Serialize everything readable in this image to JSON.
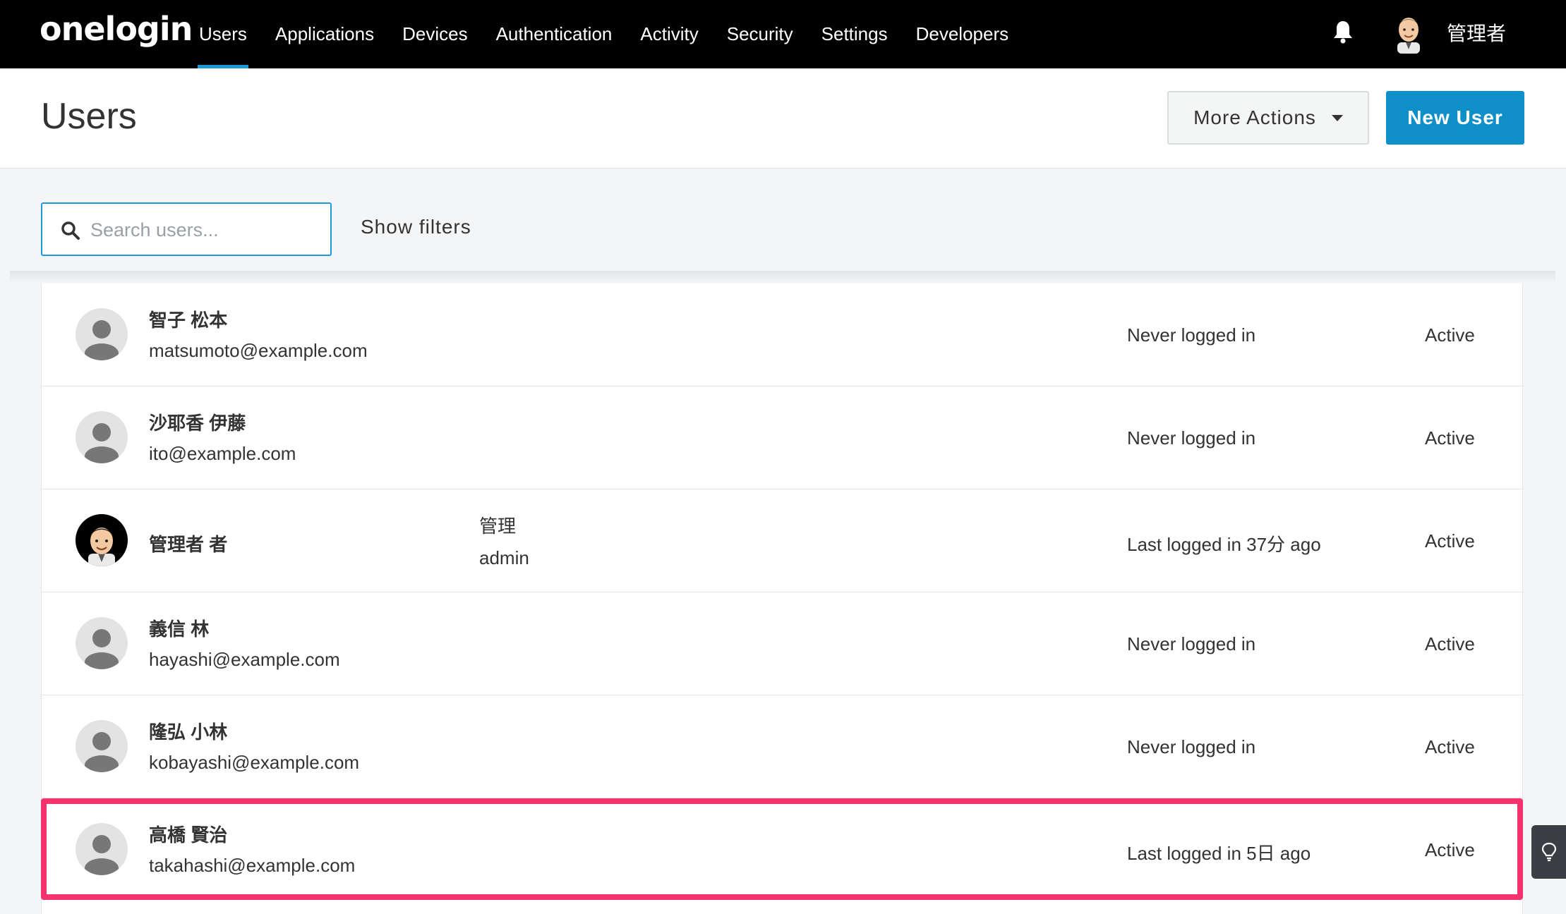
{
  "app": {
    "logo": "onelogin",
    "user_name": "管理者"
  },
  "nav": [
    {
      "label": "Users",
      "active": true
    },
    {
      "label": "Applications"
    },
    {
      "label": "Devices"
    },
    {
      "label": "Authentication"
    },
    {
      "label": "Activity"
    },
    {
      "label": "Security"
    },
    {
      "label": "Settings"
    },
    {
      "label": "Developers"
    }
  ],
  "header": {
    "title": "Users",
    "more_actions_label": "More Actions",
    "new_user_label": "New User"
  },
  "search": {
    "placeholder": "Search users...",
    "value": "",
    "show_filters_label": "Show filters"
  },
  "users": [
    {
      "name": "智子 松本",
      "email": "matsumoto@example.com",
      "last_login": "Never logged in",
      "status": "Active"
    },
    {
      "name": "沙耶香 伊藤",
      "email": "ito@example.com",
      "last_login": "Never logged in",
      "status": "Active"
    },
    {
      "name": "管理者 者",
      "role_1": "管理",
      "role_2": "admin",
      "last_login": "Last logged in 37分 ago",
      "status": "Active"
    },
    {
      "name": "義信 林",
      "email": "hayashi@example.com",
      "last_login": "Never logged in",
      "status": "Active"
    },
    {
      "name": "隆弘 小林",
      "email": "kobayashi@example.com",
      "last_login": "Never logged in",
      "status": "Active"
    },
    {
      "name": "高橋 賢治",
      "email": "takahashi@example.com",
      "last_login": "Last logged in 5日 ago",
      "status": "Active",
      "highlighted": true
    }
  ],
  "colors": {
    "accent": "#0f8fc8",
    "highlight": "#f5336f",
    "topbar": "#000000"
  },
  "icons": {
    "bell": "bell-icon",
    "search": "search-icon",
    "caret": "chevron-down-icon",
    "avatar_default": "default-avatar-icon",
    "bulb": "lightbulb-icon"
  }
}
